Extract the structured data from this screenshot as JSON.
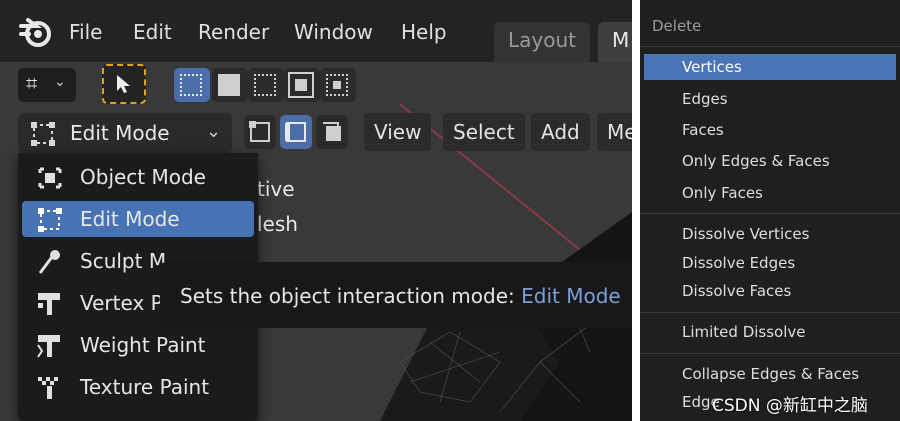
{
  "menubar": {
    "items": [
      "File",
      "Edit",
      "Render",
      "Window",
      "Help"
    ],
    "workspaces": [
      "Layout",
      "M"
    ]
  },
  "header": {
    "mode_label": "Edit Mode",
    "buttons": [
      "View",
      "Select",
      "Add",
      "Me"
    ]
  },
  "mode_menu": {
    "items": [
      {
        "label": "Object Mode",
        "icon": "object-mode-icon"
      },
      {
        "label": "Edit Mode",
        "icon": "edit-mode-icon"
      },
      {
        "label": "Sculpt Mode",
        "icon": "sculpt-mode-icon"
      },
      {
        "label": "Vertex Paint",
        "icon": "vertex-paint-icon"
      },
      {
        "label": "Weight Paint",
        "icon": "weight-paint-icon"
      },
      {
        "label": "Texture Paint",
        "icon": "texture-paint-icon"
      }
    ],
    "visible_labels": [
      "Object Mode",
      "Edit Mode",
      "Sculpt M",
      "Vertex P",
      "Weight Paint",
      "Texture Paint"
    ]
  },
  "viewport": {
    "overlay_line1": "tive",
    "overlay_line2": "lesh"
  },
  "tooltip": {
    "text": "Sets the object interaction mode: ",
    "value": "Edit Mode"
  },
  "delete_menu": {
    "title": "Delete",
    "groups": [
      [
        "Vertices",
        "Edges",
        "Faces",
        "Only Edges & Faces",
        "Only Faces"
      ],
      [
        "Dissolve Vertices",
        "Dissolve Edges",
        "Dissolve Faces"
      ],
      [
        "Limited Dissolve"
      ],
      [
        "Collapse Edges & Faces",
        "Edge"
      ]
    ]
  },
  "watermark": "CSDN @新缸中之脑",
  "colors": {
    "accent": "#4772b3",
    "tooltip_value": "#7d9fd8",
    "menu_bg": "#1b1b1b"
  }
}
